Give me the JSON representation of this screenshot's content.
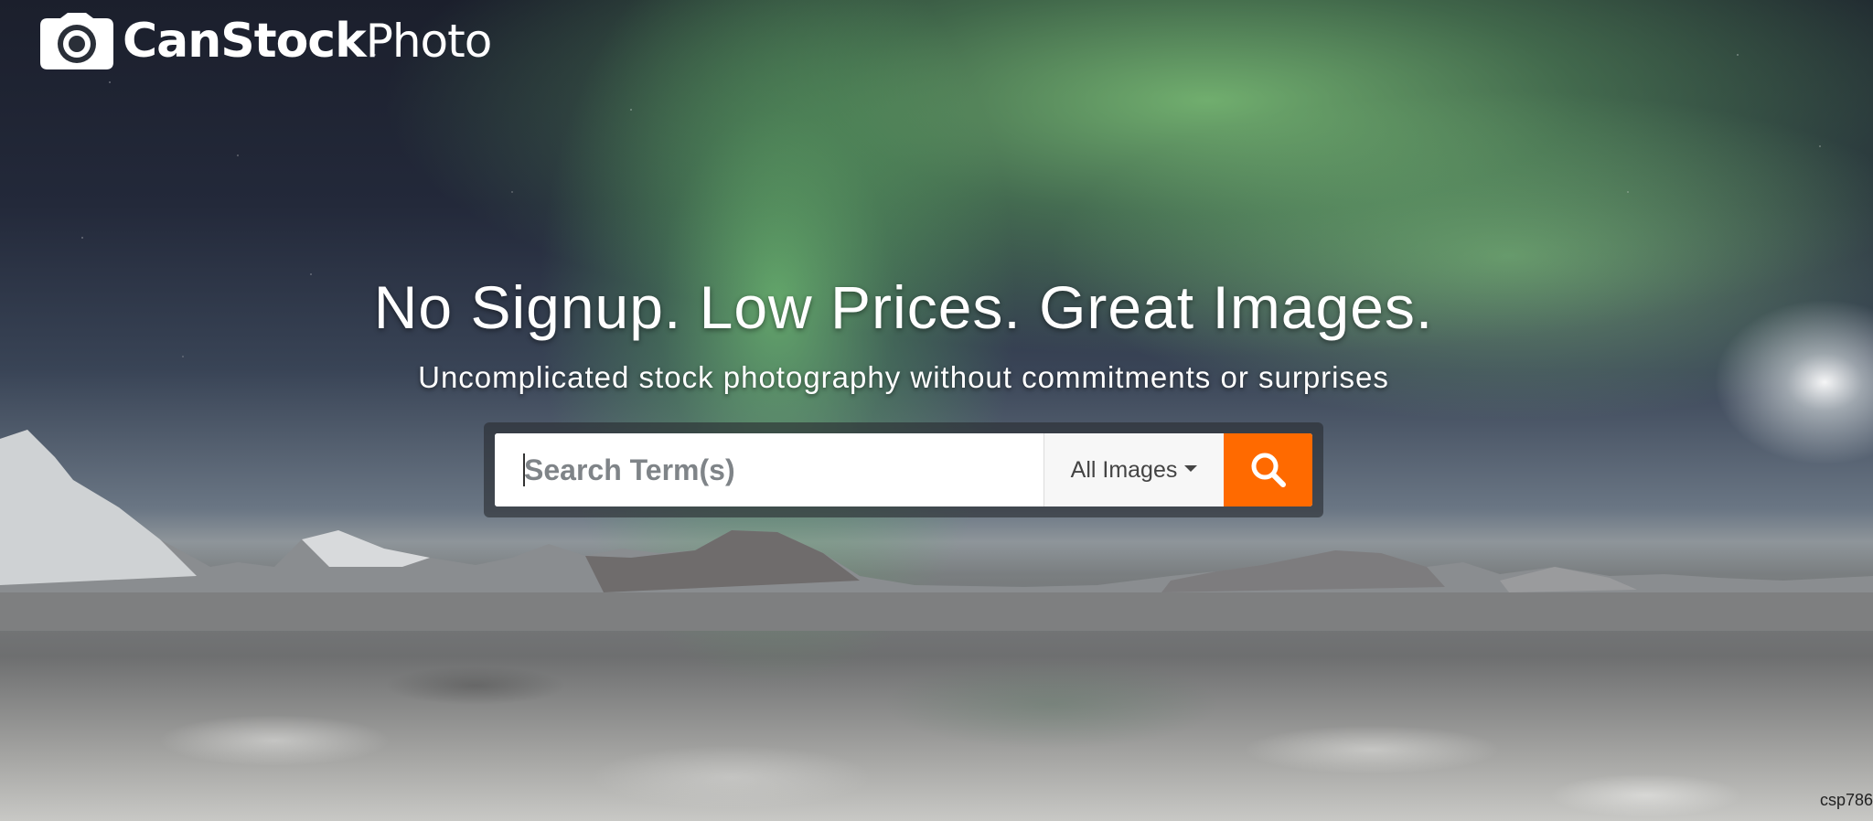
{
  "brand": {
    "name_bold": "CanStock",
    "name_light": "Photo",
    "logo_icon": "camera-icon"
  },
  "hero": {
    "headline": "No Signup. Low Prices. Great Images.",
    "subheadline": "Uncomplicated stock photography without commitments or surprises"
  },
  "search": {
    "placeholder": "Search Term(s)",
    "value": "",
    "type_selected": "All Images",
    "submit_icon": "search-icon",
    "submit_label": "Search"
  },
  "image_credit": "csp786",
  "colors": {
    "accent": "#ff6a00",
    "text_on_hero": "#ffffff"
  }
}
